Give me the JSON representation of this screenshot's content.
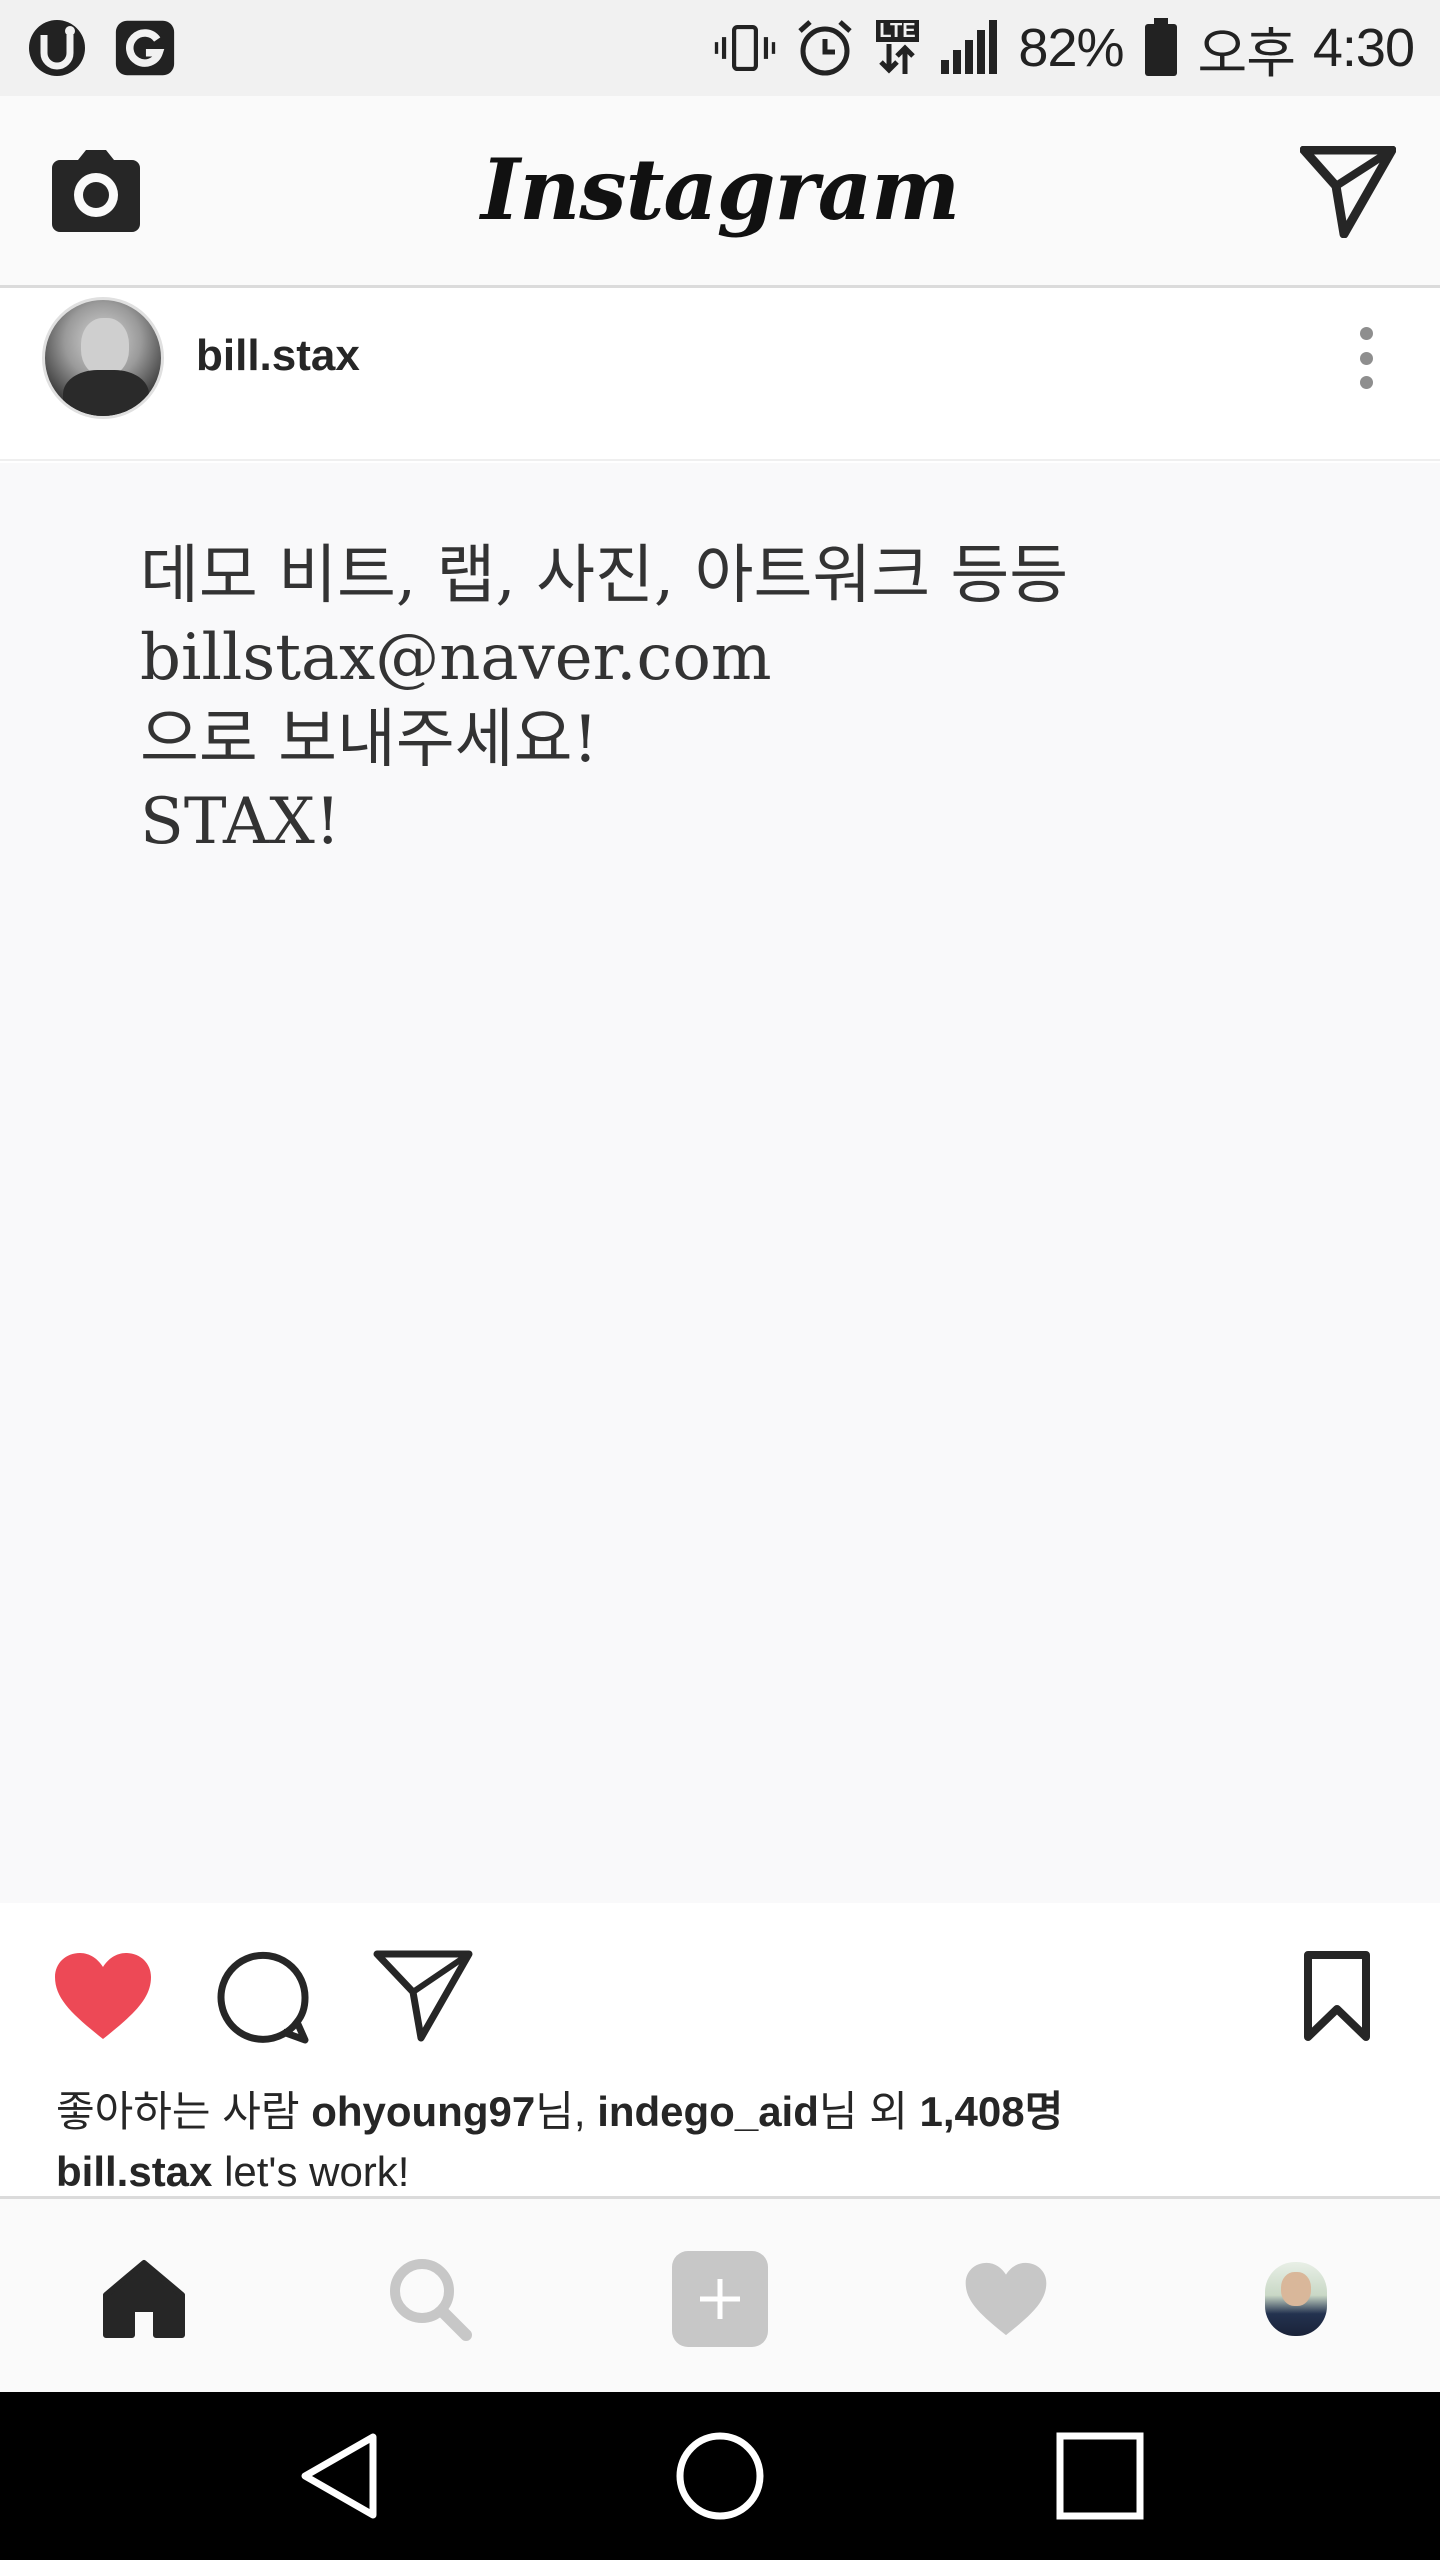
{
  "status_bar": {
    "battery": "82%",
    "ampm": "오후",
    "time": "4:30",
    "lte": "LTE"
  },
  "app_bar": {
    "logo": "Instagram"
  },
  "post": {
    "username": "bill.stax",
    "image_text": [
      "데모 비트, 랩, 사진, 아트워크 등등",
      "billstax@naver.com",
      "으로 보내주세요!",
      "STAX!"
    ],
    "likes": {
      "prefix": "좋아하는 사람 ",
      "user1": "ohyoung97",
      "sep1": "님, ",
      "user2": "indego_aid",
      "sep2": "님 외 ",
      "count": "1,408명"
    },
    "caption": {
      "username": "bill.stax",
      "text": " let's work!"
    }
  },
  "colors": {
    "like_red": "#ed4956",
    "icon_dark": "#262626",
    "nav_inactive": "#c7c7c7"
  }
}
